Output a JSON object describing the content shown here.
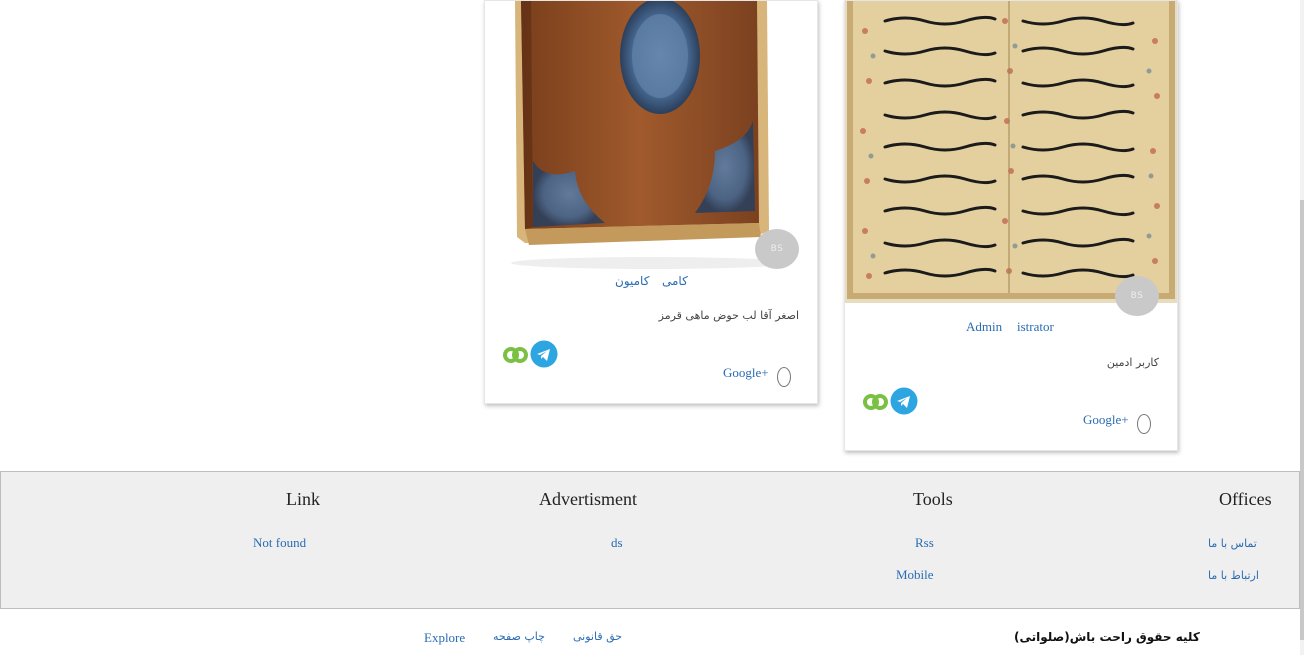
{
  "cards": [
    {
      "avatar_text": "BS",
      "tags": [
        "کامی",
        "کامیون"
      ],
      "caption": "اصغر آقا لب حوض ماهی قرمز",
      "share_icons": [
        "eitaa-icon",
        "telegram-icon"
      ],
      "gplus_label": "Google+"
    },
    {
      "avatar_text": "BS",
      "tags": [
        "Admin",
        "istrator"
      ],
      "caption": "کاربر ادمین",
      "share_icons": [
        "eitaa-icon",
        "telegram-icon"
      ],
      "gplus_label": "Google+"
    }
  ],
  "footer": {
    "columns": [
      {
        "title": "Link",
        "links": [
          "Not found"
        ]
      },
      {
        "title": "Advertisment",
        "links": [
          "ds"
        ]
      },
      {
        "title": "Tools",
        "links": [
          "Rss",
          "Mobile"
        ]
      },
      {
        "title": "Offices",
        "links": [
          "تماس با ما",
          "ارتباط با ما"
        ]
      }
    ],
    "bottom_links": [
      "Explore",
      "چاپ صفحه",
      "حق قانونی"
    ],
    "copyright": "کلیه حقوق راحت باش(صلواتی)"
  },
  "colors": {
    "link": "#2a6cb3",
    "footer_bg": "#efefef",
    "telegram": "#2ca5e0",
    "eitaa": "#7ac143"
  }
}
